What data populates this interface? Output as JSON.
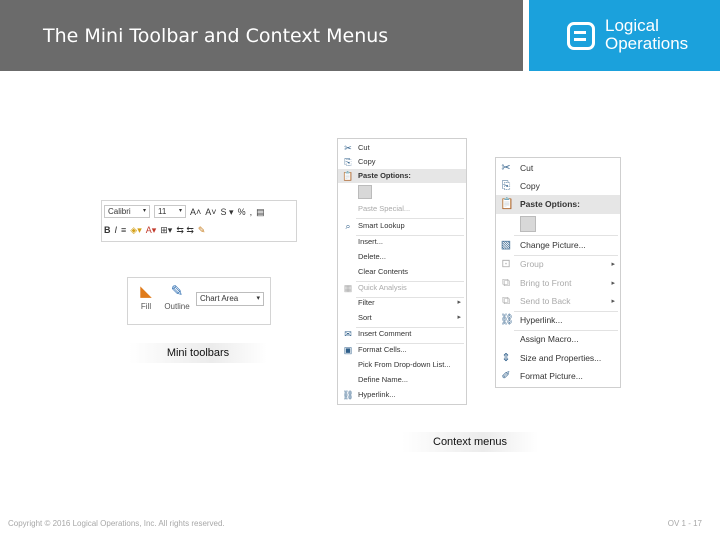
{
  "header": {
    "title": "The Mini Toolbar and Context Menus"
  },
  "logo": {
    "line1": "Logical",
    "line2": "Operations",
    "color": "#1ba1dc"
  },
  "mini_toolbar_format": {
    "font_name": "Calibri",
    "font_size": "11",
    "icons": [
      "grow-font-icon",
      "shrink-font-icon",
      "styles-icon",
      "percent-icon",
      "format-painter-icon",
      "bold-icon",
      "italic-icon",
      "align-icon",
      "fill-color-icon",
      "font-color-icon",
      "borders-icon",
      "decimal-icon"
    ]
  },
  "mini_toolbar_chart": {
    "fill_label": "Fill",
    "outline_label": "Outline",
    "selection": "Chart Area"
  },
  "captions": {
    "mini_toolbars": "Mini toolbars",
    "context_menus": "Context menus"
  },
  "context_menu_cells": {
    "items": [
      {
        "label": "Cut",
        "icon": "scissors-icon"
      },
      {
        "label": "Copy",
        "icon": "copy-icon"
      },
      {
        "label": "Paste Options:",
        "icon": "paste-icon",
        "highlighted": true
      },
      {
        "label": "Paste Special...",
        "icon": "",
        "dim": true
      },
      {
        "label": "Smart Lookup",
        "icon": "search-icon"
      },
      {
        "label": "Insert...",
        "icon": ""
      },
      {
        "label": "Delete...",
        "icon": ""
      },
      {
        "label": "Clear Contents",
        "icon": ""
      },
      {
        "label": "Quick Analysis",
        "icon": "quick-analysis-icon",
        "dim": true
      },
      {
        "label": "Filter",
        "icon": "",
        "submenu": true
      },
      {
        "label": "Sort",
        "icon": "",
        "submenu": true
      },
      {
        "label": "Insert Comment",
        "icon": "comment-icon"
      },
      {
        "label": "Format Cells...",
        "icon": "format-cells-icon"
      },
      {
        "label": "Pick From Drop-down List...",
        "icon": ""
      },
      {
        "label": "Define Name...",
        "icon": ""
      },
      {
        "label": "Hyperlink...",
        "icon": "hyperlink-icon"
      }
    ]
  },
  "context_menu_picture": {
    "items": [
      {
        "label": "Cut",
        "icon": "scissors-icon"
      },
      {
        "label": "Copy",
        "icon": "copy-icon"
      },
      {
        "label": "Paste Options:",
        "icon": "paste-icon",
        "highlighted": true
      },
      {
        "label": "Change Picture...",
        "icon": "change-picture-icon"
      },
      {
        "label": "Group",
        "icon": "group-icon",
        "dim": true,
        "submenu": true
      },
      {
        "label": "Bring to Front",
        "icon": "bring-front-icon",
        "dim": true,
        "submenu": true
      },
      {
        "label": "Send to Back",
        "icon": "send-back-icon",
        "dim": true,
        "submenu": true
      },
      {
        "label": "Hyperlink...",
        "icon": "hyperlink-icon"
      },
      {
        "label": "Assign Macro...",
        "icon": ""
      },
      {
        "label": "Size and Properties...",
        "icon": "size-properties-icon"
      },
      {
        "label": "Format Picture...",
        "icon": "format-picture-icon"
      }
    ]
  },
  "footer": {
    "copyright": "Copyright © 2016 Logical Operations, Inc. All rights reserved.",
    "page": "OV 1 - 17"
  }
}
